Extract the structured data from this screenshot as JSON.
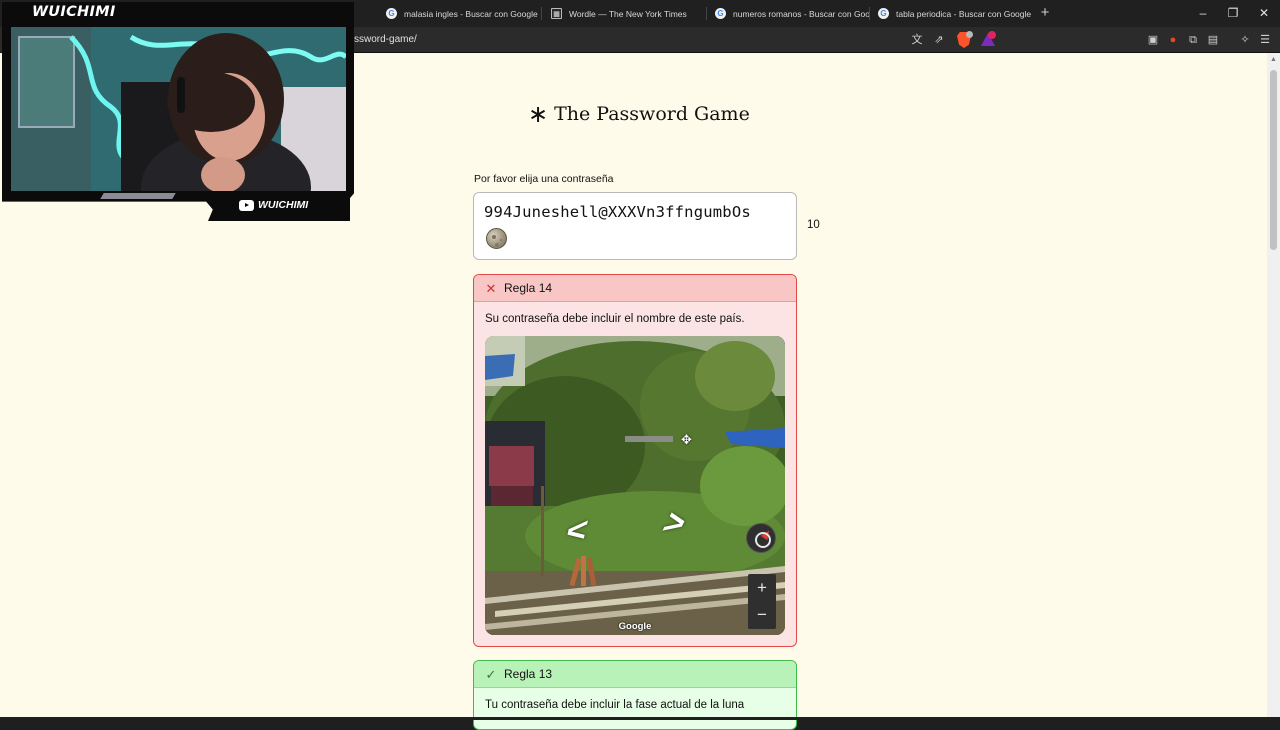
{
  "browser": {
    "tabs": [
      {
        "label": "malasia ingles - Buscar con Google",
        "favicon": "google-icon"
      },
      {
        "label": "Wordle — The New York Times",
        "favicon": "nyt-icon"
      },
      {
        "label": "numeros romanos - Buscar con Goog",
        "favicon": "google-icon"
      },
      {
        "label": "tabla periodica - Buscar con Google",
        "favicon": "google-icon"
      }
    ],
    "url": "ssword-game/"
  },
  "page": {
    "title": "The Password Game",
    "title_icon": "asterisk-icon",
    "password_label": "Por favor elija una contraseña",
    "password_value": "994Juneshell@XXXVn3ffngumbOs",
    "password_emoji": "moon-emoji",
    "password_length": "10",
    "rules": [
      {
        "status": "fail",
        "title": "Regla 14",
        "text": "Su contraseña debe incluir el nombre de este país.",
        "streetview": {
          "attribution": "Google",
          "zoom_in": "+",
          "zoom_out": "−"
        }
      },
      {
        "status": "pass",
        "title": "Regla 13",
        "text": "Tu contraseña debe incluir la fase actual de la luna"
      }
    ]
  },
  "webcam": {
    "brand": "WUICHIMI",
    "handle": "WUICHIMI"
  },
  "colors": {
    "page_bg": "#fffbeb",
    "rule_fail_border": "#e34a4a",
    "rule_fail_header": "#f9c6c6",
    "rule_pass_border": "#3fbb4b",
    "rule_pass_header": "#b9f2b9"
  }
}
